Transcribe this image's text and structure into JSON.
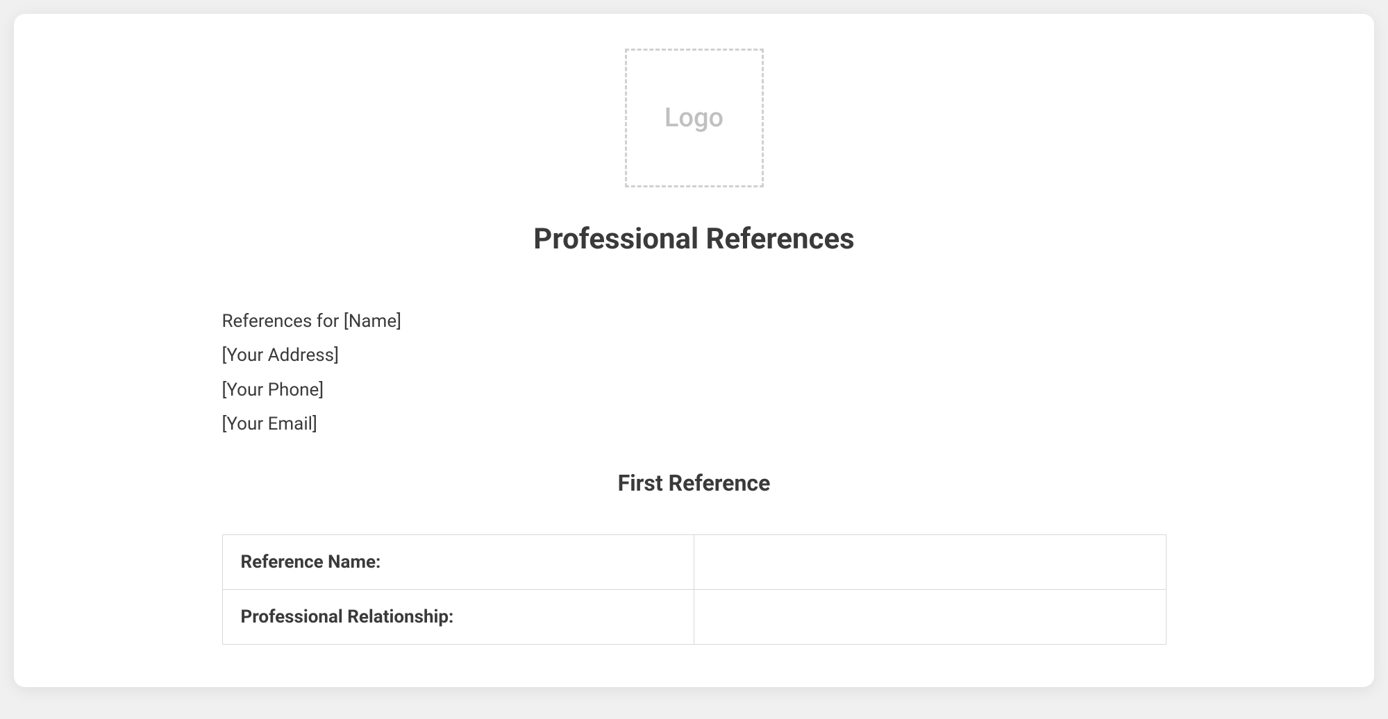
{
  "logo": {
    "placeholder_text": "Logo"
  },
  "title": "Professional References",
  "applicant": {
    "references_for": "References for [Name]",
    "address": "[Your Address]",
    "phone": "[Your Phone]",
    "email": "[Your Email]"
  },
  "sections": {
    "first_reference": {
      "heading": "First Reference",
      "fields": {
        "reference_name": {
          "label": "Reference Name:",
          "value": ""
        },
        "professional_relationship": {
          "label": "Professional Relationship:",
          "value": ""
        }
      }
    }
  }
}
